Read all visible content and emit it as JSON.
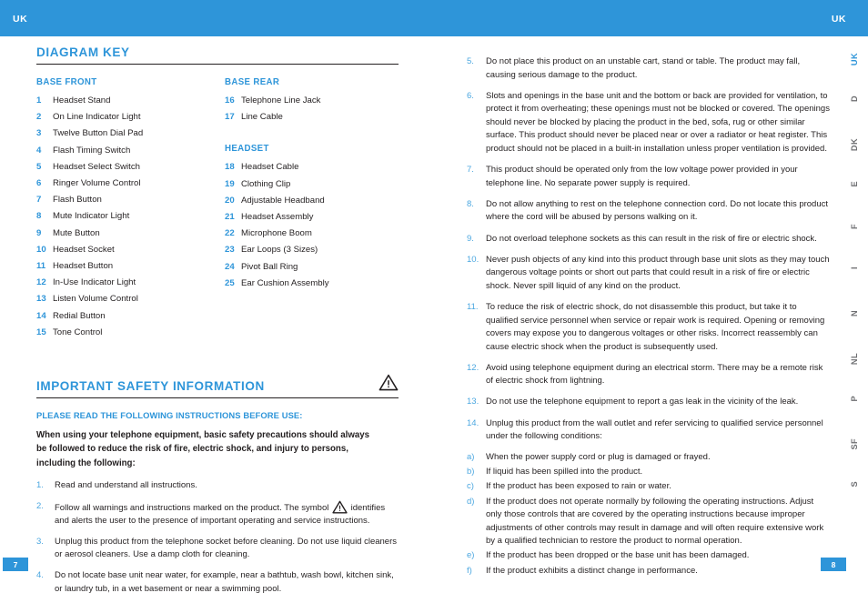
{
  "header": {
    "lang_left": "UK",
    "lang_right": "UK",
    "accent_color": "#2E95D9"
  },
  "diagram_key": {
    "heading": "DIAGRAM KEY",
    "groups": [
      {
        "title": "BASE FRONT",
        "items": [
          {
            "num": "1",
            "label": "Headset Stand"
          },
          {
            "num": "2",
            "label": "On Line Indicator Light"
          },
          {
            "num": "3",
            "label": "Twelve Button Dial Pad"
          },
          {
            "num": "4",
            "label": "Flash Timing Switch"
          },
          {
            "num": "5",
            "label": "Headset Select Switch"
          },
          {
            "num": "6",
            "label": "Ringer Volume Control"
          },
          {
            "num": "7",
            "label": "Flash Button"
          },
          {
            "num": "8",
            "label": "Mute Indicator Light"
          },
          {
            "num": "9",
            "label": "Mute Button"
          },
          {
            "num": "10",
            "label": "Headset Socket"
          },
          {
            "num": "11",
            "label": "Headset Button"
          },
          {
            "num": "12",
            "label": "In-Use Indicator Light"
          },
          {
            "num": "13",
            "label": "Listen Volume Control"
          },
          {
            "num": "14",
            "label": "Redial Button"
          },
          {
            "num": "15",
            "label": "Tone Control"
          }
        ]
      },
      {
        "title": "BASE REAR",
        "items": [
          {
            "num": "16",
            "label": "Telephone Line Jack"
          },
          {
            "num": "17",
            "label": "Line Cable"
          }
        ]
      },
      {
        "title": "HEADSET",
        "items": [
          {
            "num": "18",
            "label": "Headset Cable"
          },
          {
            "num": "19",
            "label": "Clothing Clip"
          },
          {
            "num": "20",
            "label": "Adjustable Headband"
          },
          {
            "num": "21",
            "label": "Headset Assembly"
          },
          {
            "num": "22",
            "label": "Microphone Boom"
          },
          {
            "num": "23",
            "label": "Ear Loops (3 Sizes)"
          },
          {
            "num": "24",
            "label": "Pivot Ball Ring"
          },
          {
            "num": "25",
            "label": "Ear Cushion Assembly"
          }
        ]
      }
    ]
  },
  "safety": {
    "heading": "IMPORTANT SAFETY INFORMATION",
    "warning_icon": "warning-triangle-icon",
    "subheading": "PLEASE READ THE FOLLOWING INSTRUCTIONS BEFORE USE:",
    "intro": "When using your telephone equipment, basic safety precautions should always be followed to reduce the risk of fire, electric shock, and injury to persons, including the following:",
    "items_left": [
      {
        "num": "1.",
        "text": "Read and understand all instructions."
      },
      {
        "num": "2.",
        "text_before": "Follow all warnings and instructions marked on the product. The symbol",
        "has_inline_icon": true,
        "text_after": "identifies and alerts the user to the presence of important operating and service instructions."
      },
      {
        "num": "3.",
        "text": "Unplug this product from the telephone socket before cleaning. Do not use liquid cleaners or aerosol cleaners. Use a damp cloth for cleaning."
      },
      {
        "num": "4.",
        "text": "Do not locate base unit near water, for example, near a bathtub, wash bowl, kitchen sink, or laundry tub, in a wet basement or near a swimming pool."
      }
    ],
    "items_right": [
      {
        "num": "5.",
        "text": "Do not place this product on an unstable cart, stand or table. The product may fall, causing serious damage to the product."
      },
      {
        "num": "6.",
        "text": "Slots and openings in the base unit and the bottom or back are provided for ventilation, to protect it from overheating; these openings must not be blocked or covered. The openings should never be blocked by placing the product in the bed, sofa, rug or other similar surface. This product should never be placed near or over a radiator or heat register. This product should not be placed in a built-in installation unless proper ventilation is provided."
      },
      {
        "num": "7.",
        "text": "This product should be operated only from the low voltage power provided in your telephone line. No separate power supply is required."
      },
      {
        "num": "8.",
        "text": "Do not allow anything to rest on the telephone connection cord. Do not locate this product where the cord will be abused by persons walking on it."
      },
      {
        "num": "9.",
        "text": "Do not overload telephone sockets as this can result in the risk of fire or electric shock."
      },
      {
        "num": "10.",
        "text": "Never push objects of any kind into this product through base unit slots as they may touch dangerous voltage points or short out parts that could result in a risk of fire or electric shock. Never spill liquid of any kind on the product."
      },
      {
        "num": "11.",
        "text": "To reduce the risk of electric shock, do not disassemble this product, but take it to qualified service personnel when service or repair work is required. Opening or removing covers may expose you to dangerous voltages or other risks. Incorrect reassembly can cause electric shock when the product is subsequently used."
      },
      {
        "num": "12.",
        "text": "Avoid using telephone equipment during an electrical storm. There may be a remote risk of electric shock from lightning."
      },
      {
        "num": "13.",
        "text": "Do not use the telephone equipment to report a gas leak in the vicinity of the leak."
      },
      {
        "num": "14.",
        "text": "Unplug this product from the wall outlet and refer servicing to qualified service personnel under the following conditions:"
      }
    ],
    "sub_items": [
      {
        "marker": "a)",
        "text": "When the power supply cord or plug is damaged or frayed."
      },
      {
        "marker": "b)",
        "text": "If liquid has been spilled into the product."
      },
      {
        "marker": "c)",
        "text": "If the product has been exposed to rain or water."
      },
      {
        "marker": "d)",
        "text": "If the product does not operate normally by following the operating instructions. Adjust only those controls that are covered by the operating instructions because improper adjustments of other controls may result in damage and will often require extensive work by a qualified technician to restore the product to normal operation."
      },
      {
        "marker": "e)",
        "text": "If the product has been dropped or the base unit has been damaged."
      },
      {
        "marker": "f)",
        "text": "If the product exhibits a distinct change in performance."
      }
    ]
  },
  "language_tabs": [
    {
      "label": "UK",
      "active": true
    },
    {
      "label": "D",
      "active": false
    },
    {
      "label": "DK",
      "active": false
    },
    {
      "label": "E",
      "active": false
    },
    {
      "label": "F",
      "active": false
    },
    {
      "label": "I",
      "active": false
    },
    {
      "label": "N",
      "active": false
    },
    {
      "label": "NL",
      "active": false
    },
    {
      "label": "P",
      "active": false
    },
    {
      "label": "SF",
      "active": false
    },
    {
      "label": "S",
      "active": false
    }
  ],
  "page_numbers": {
    "left": "7",
    "right": "8"
  }
}
